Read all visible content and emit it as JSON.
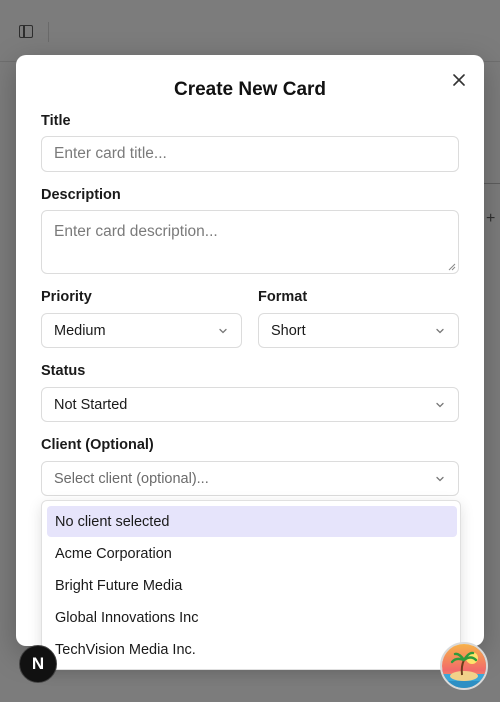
{
  "modal": {
    "title": "Create New Card",
    "close_icon": "close-icon"
  },
  "form": {
    "title_label": "Title",
    "title_placeholder": "Enter card title...",
    "title_value": "",
    "description_label": "Description",
    "description_placeholder": "Enter card description...",
    "description_value": "",
    "priority_label": "Priority",
    "priority_value": "Medium",
    "format_label": "Format",
    "format_value": "Short",
    "status_label": "Status",
    "status_value": "Not Started",
    "client_label": "Client (Optional)",
    "client_placeholder": "Select client (optional)..."
  },
  "client_dropdown": {
    "options": [
      {
        "label": "No client selected",
        "selected": true
      },
      {
        "label": "Acme Corporation",
        "selected": false
      },
      {
        "label": "Bright Future Media",
        "selected": false
      },
      {
        "label": "Global Innovations Inc",
        "selected": false
      },
      {
        "label": "TechVision Media Inc."
      }
    ]
  },
  "badges": {
    "framework_letter": "N"
  },
  "colors": {
    "overlay": "#7c7c7c",
    "selected_option_bg": "#e6e4fb",
    "modal_bg": "#ffffff"
  }
}
